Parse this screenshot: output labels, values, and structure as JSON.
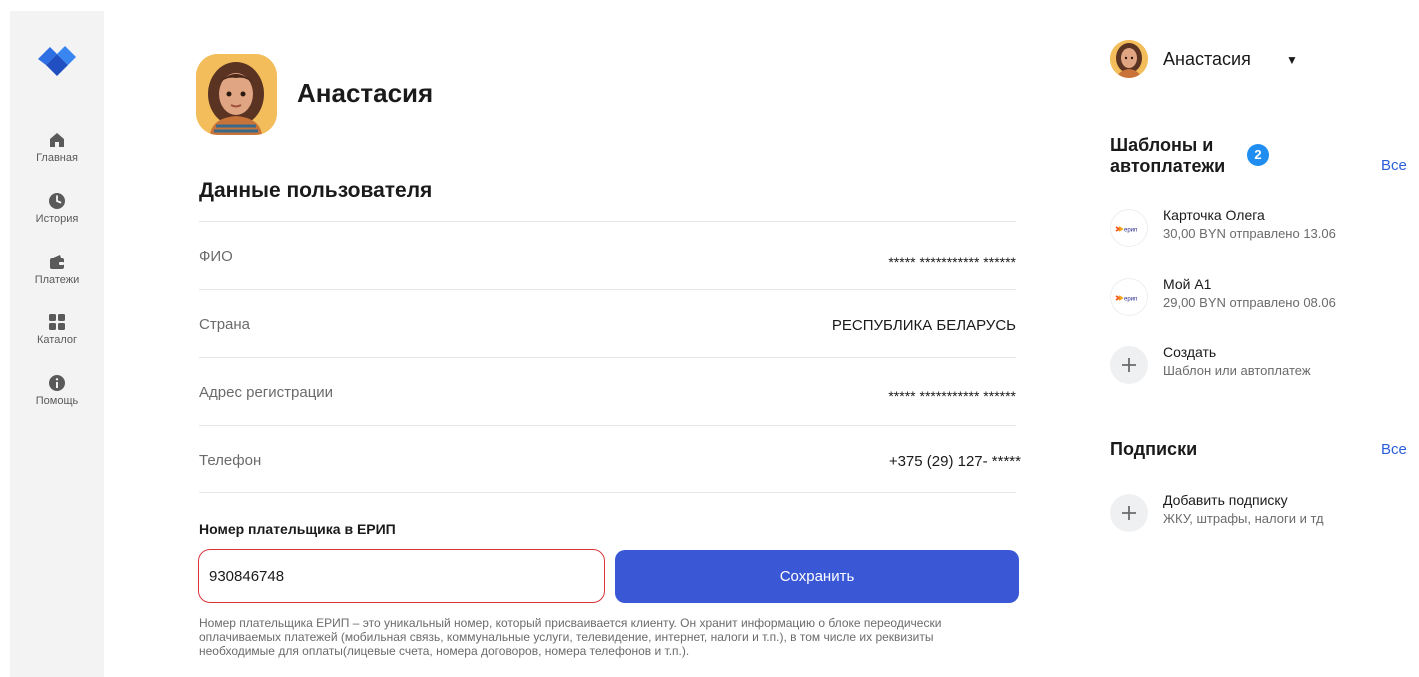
{
  "sidebar": {
    "items": [
      {
        "label": "Главная",
        "icon": "home-icon"
      },
      {
        "label": "История",
        "icon": "clock-icon"
      },
      {
        "label": "Платежи",
        "icon": "wallet-icon"
      },
      {
        "label": "Каталог",
        "icon": "grid-icon"
      },
      {
        "label": "Помощь",
        "icon": "info-icon"
      }
    ]
  },
  "profile": {
    "name": "Анастасия"
  },
  "user_data": {
    "title": "Данные пользователя",
    "rows": [
      {
        "label": "ФИО",
        "value": "***** *********** ******"
      },
      {
        "label": "Страна",
        "value": "РЕСПУБЛИКА БЕЛАРУСЬ"
      },
      {
        "label": "Адрес регистрации",
        "value": "***** *********** ******"
      },
      {
        "label": "Телефон",
        "value": "+375 (29) 127- *****"
      }
    ]
  },
  "erip": {
    "label": "Номер плательщика в ЕРИП",
    "value": "930846748",
    "save_label": "Сохранить",
    "hint": "Номер плательщика ЕРИП – это уникальный номер, который присваивается клиенту. Он хранит информацию о блоке переодически оплачиваемых платежей (мобильная связь, коммунальные услуги, телевидение, интернет, налоги и т.п.), в том числе их реквизиты необходимые для оплаты(лицевые счета, номера договоров, номера телефонов и т.п.)."
  },
  "top_user": {
    "name": "Анастасия",
    "caret": "▼"
  },
  "templates": {
    "title_line1": "Шаблоны и",
    "title_line2": "автоплатежи",
    "badge": "2",
    "all_label": "Все",
    "items": [
      {
        "name": "Карточка Олега",
        "sub": "30,00 BYN отправлено 13.06",
        "icon": "erip-icon",
        "logo_text": "ерип"
      },
      {
        "name": "Мой А1",
        "sub": "29,00 BYN отправлено 08.06",
        "icon": "erip-icon",
        "logo_text": "ерип"
      },
      {
        "name": "Создать",
        "sub": "Шаблон или автоплатеж",
        "icon": "plus-icon"
      }
    ]
  },
  "subscriptions": {
    "title": "Подписки",
    "all_label": "Все",
    "items": [
      {
        "name": "Добавить подписку",
        "sub": "ЖКУ, штрафы, налоги и тд",
        "icon": "plus-icon"
      }
    ]
  },
  "colors": {
    "accent": "#3a58d6",
    "error_border": "#d8353b",
    "badge": "#1f8ef0",
    "link": "#2b5fd9"
  }
}
